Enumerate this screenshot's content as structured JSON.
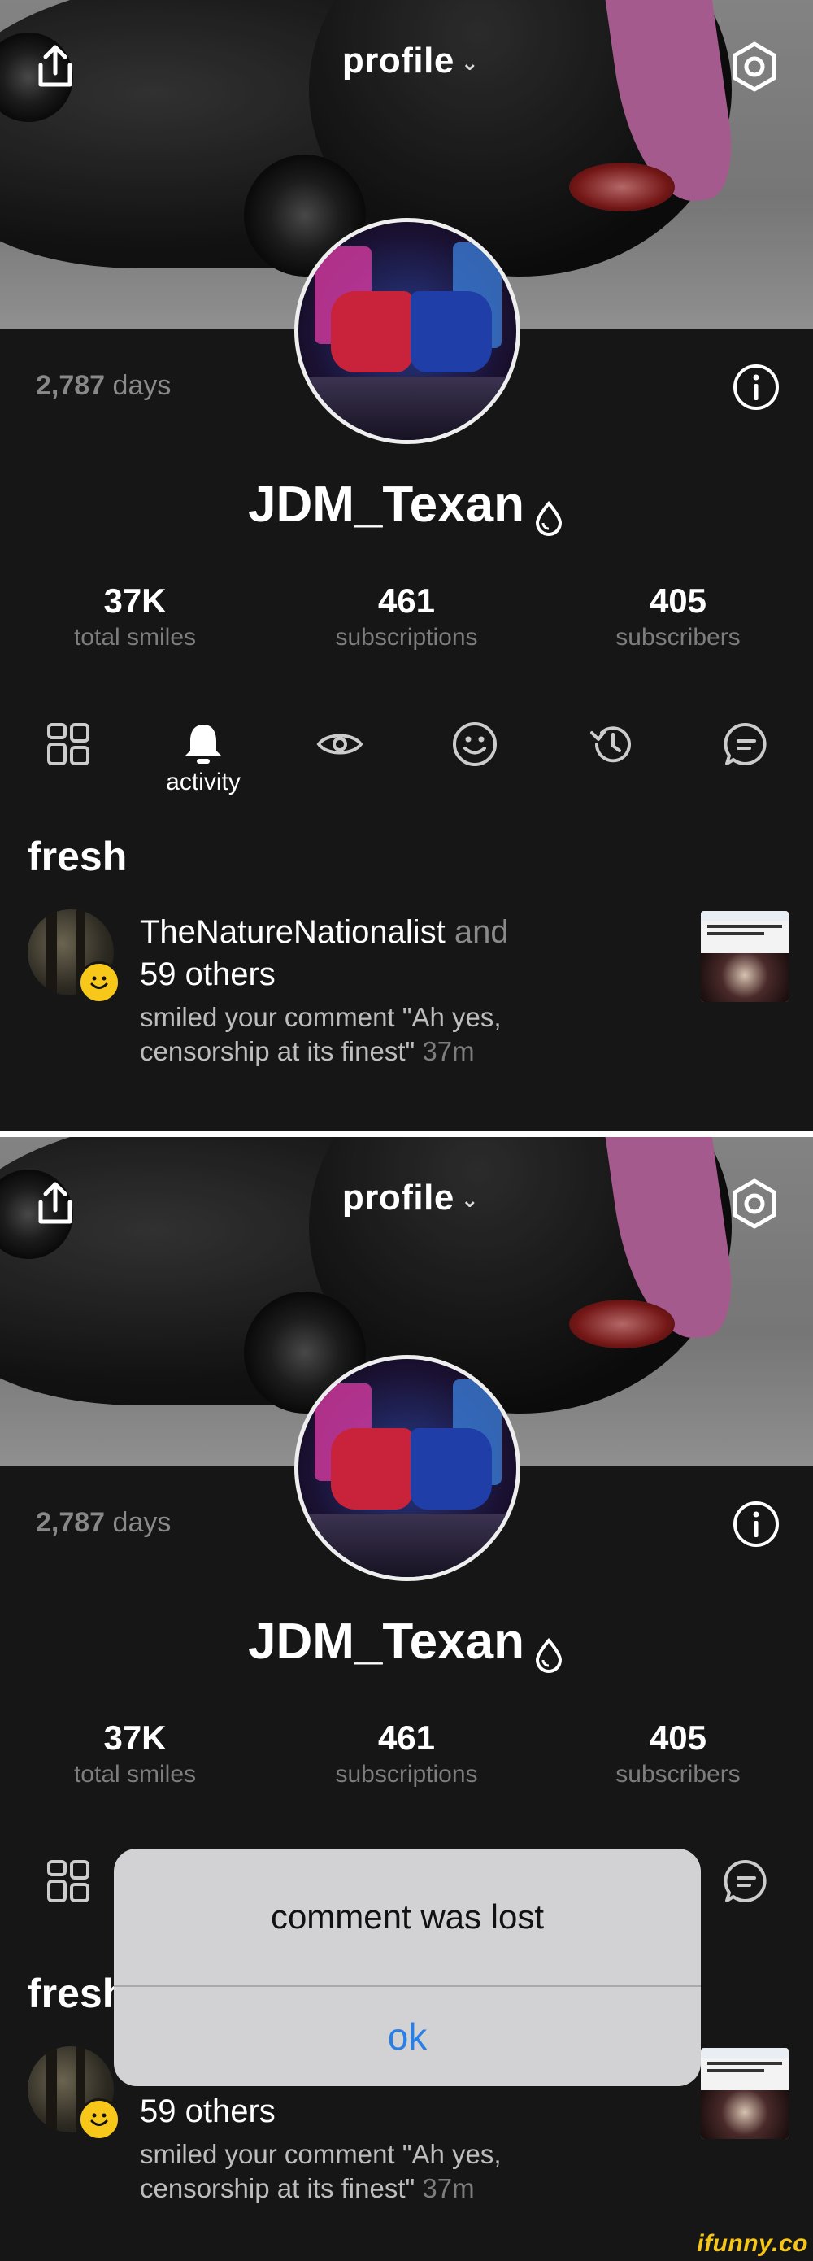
{
  "header": {
    "title": "profile",
    "title_chevron": "⌄"
  },
  "profile": {
    "days_count": "2,787",
    "days_label": "days",
    "username": "JDM_Texan"
  },
  "stats": [
    {
      "value": "37K",
      "label": "total smiles"
    },
    {
      "value": "461",
      "label": "subscriptions"
    },
    {
      "value": "405",
      "label": "subscribers"
    }
  ],
  "tabs": {
    "active_label": "activity",
    "items": [
      "grid-icon",
      "bell-icon",
      "eye-icon",
      "smile-icon",
      "history-icon",
      "chat-icon"
    ]
  },
  "section": {
    "title": "fresh"
  },
  "feed_item": {
    "user": "TheNatureNationalist",
    "and": "and",
    "others": "59 others",
    "text": "smiled your comment \"Ah yes, censorship at its finest\"",
    "time": "37m"
  },
  "dialog": {
    "message": "comment was lost",
    "button": "ok"
  },
  "watermark": "ifunny.co",
  "colors": {
    "background": "#161616",
    "accent_blue": "#2a7fe6",
    "badge_yellow": "#f7c71a",
    "dialog_bg": "#d2d2d4"
  }
}
